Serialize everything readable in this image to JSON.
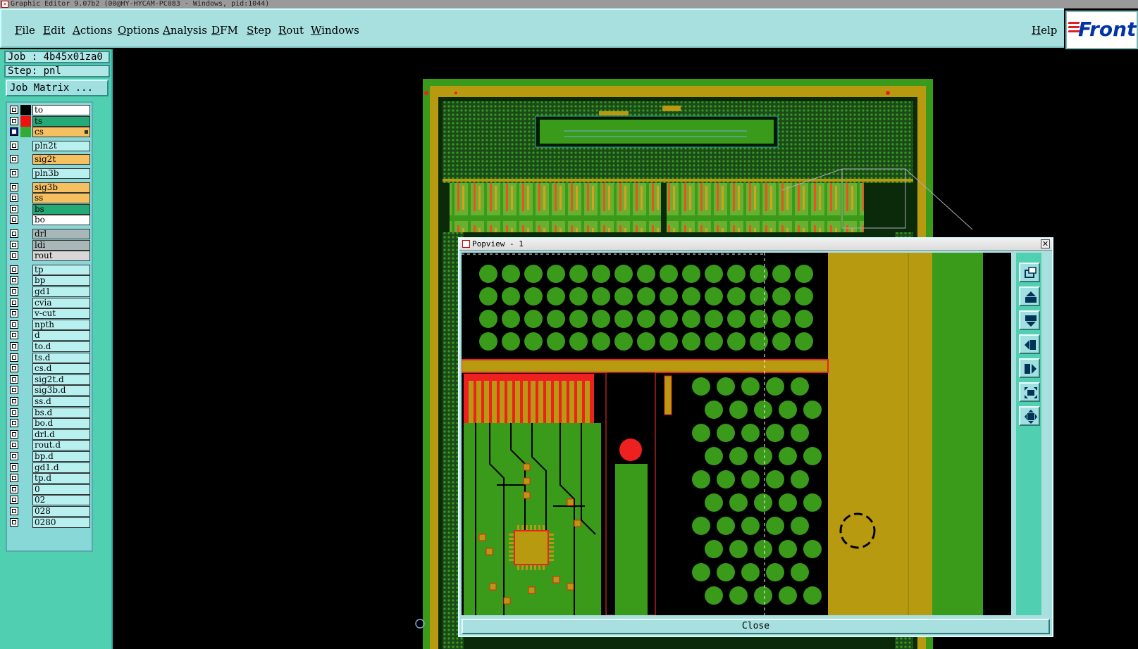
{
  "window": {
    "title": "Graphic Editor 9.07b2 (00@HY-HYCAM-PC083 - Windows, pid:1044)"
  },
  "menu": {
    "items": [
      "File",
      "Edit",
      "Actions",
      "Options",
      "Analysis",
      "DFM",
      "Step",
      "Rout",
      "Windows"
    ],
    "help": "Help"
  },
  "logo": {
    "text": "Front"
  },
  "job": {
    "job_label": "Job : 4b45x01za0",
    "step_label": "Step: pnl",
    "matrix_button": "Job Matrix ..."
  },
  "layers": [
    {
      "name": "to",
      "color": "#ffffff",
      "swatch": "#000000",
      "selected": false
    },
    {
      "name": "ts",
      "color": "#22aa77",
      "swatch": "#ee1111",
      "selected": false
    },
    {
      "name": "cs",
      "color": "#f5c060",
      "swatch": "#33aa33",
      "selected": true,
      "flag": true
    },
    {
      "name": "pln2t",
      "color": "#b8f0f0",
      "swatch": "",
      "selected": false
    },
    {
      "name": "sig2t",
      "color": "#f5c060",
      "swatch": "",
      "selected": false
    },
    {
      "name": "pln3b",
      "color": "#b8f0f0",
      "swatch": "",
      "selected": false
    },
    {
      "name": "sig3b",
      "color": "#f5c060",
      "swatch": "",
      "selected": false
    },
    {
      "name": "ss",
      "color": "#f5c060",
      "swatch": "",
      "selected": false
    },
    {
      "name": "bs",
      "color": "#22aa77",
      "swatch": "",
      "selected": false
    },
    {
      "name": "bo",
      "color": "#ffffff",
      "swatch": "",
      "selected": false
    },
    {
      "name": "drl",
      "color": "#a8b8b8",
      "swatch": "",
      "selected": false
    },
    {
      "name": "ldi",
      "color": "#a8b8b8",
      "swatch": "",
      "selected": false
    },
    {
      "name": "rout",
      "color": "#d8d8d8",
      "swatch": "",
      "selected": false
    },
    {
      "name": "tp",
      "color": "#b8f0f0",
      "swatch": "",
      "selected": false
    },
    {
      "name": "bp",
      "color": "#b8f0f0",
      "swatch": "",
      "selected": false
    },
    {
      "name": "gd1",
      "color": "#b8f0f0",
      "swatch": "",
      "selected": false
    },
    {
      "name": "cvia",
      "color": "#b8f0f0",
      "swatch": "",
      "selected": false
    },
    {
      "name": "v-cut",
      "color": "#b8f0f0",
      "swatch": "",
      "selected": false
    },
    {
      "name": "npth",
      "color": "#b8f0f0",
      "swatch": "",
      "selected": false
    },
    {
      "name": "d",
      "color": "#b8f0f0",
      "swatch": "",
      "selected": false
    },
    {
      "name": "to.d",
      "color": "#b8f0f0",
      "swatch": "",
      "selected": false
    },
    {
      "name": "ts.d",
      "color": "#b8f0f0",
      "swatch": "",
      "selected": false
    },
    {
      "name": "cs.d",
      "color": "#b8f0f0",
      "swatch": "",
      "selected": false
    },
    {
      "name": "sig2t.d",
      "color": "#b8f0f0",
      "swatch": "",
      "selected": false
    },
    {
      "name": "sig3b.d",
      "color": "#b8f0f0",
      "swatch": "",
      "selected": false
    },
    {
      "name": "ss.d",
      "color": "#b8f0f0",
      "swatch": "",
      "selected": false
    },
    {
      "name": "bs.d",
      "color": "#b8f0f0",
      "swatch": "",
      "selected": false
    },
    {
      "name": "bo.d",
      "color": "#b8f0f0",
      "swatch": "",
      "selected": false
    },
    {
      "name": "drl.d",
      "color": "#b8f0f0",
      "swatch": "",
      "selected": false
    },
    {
      "name": "rout.d",
      "color": "#b8f0f0",
      "swatch": "",
      "selected": false
    },
    {
      "name": "bp.d",
      "color": "#b8f0f0",
      "swatch": "",
      "selected": false
    },
    {
      "name": "gd1.d",
      "color": "#b8f0f0",
      "swatch": "",
      "selected": false
    },
    {
      "name": "tp.d",
      "color": "#b8f0f0",
      "swatch": "",
      "selected": false
    },
    {
      "name": "0",
      "color": "#b8f0f0",
      "swatch": "",
      "selected": false
    },
    {
      "name": "02",
      "color": "#b8f0f0",
      "swatch": "",
      "selected": false
    },
    {
      "name": "028",
      "color": "#b8f0f0",
      "swatch": "",
      "selected": false
    },
    {
      "name": "0280",
      "color": "#b8f0f0",
      "swatch": "",
      "selected": false
    }
  ],
  "popview": {
    "title": "Popview - 1",
    "close_label": "Close",
    "tools": [
      "zoom-window-icon",
      "pan-up-icon",
      "pan-down-icon",
      "pan-left-icon",
      "pan-right-icon",
      "zoom-fit-icon",
      "zoom-reset-icon"
    ]
  },
  "colors": {
    "panel_bg": "#50d0b0",
    "menu_bg": "#a8e0e0",
    "copper_green": "#3a9a1a",
    "copper_gold": "#b89a10",
    "pad_red": "#ee2020"
  }
}
